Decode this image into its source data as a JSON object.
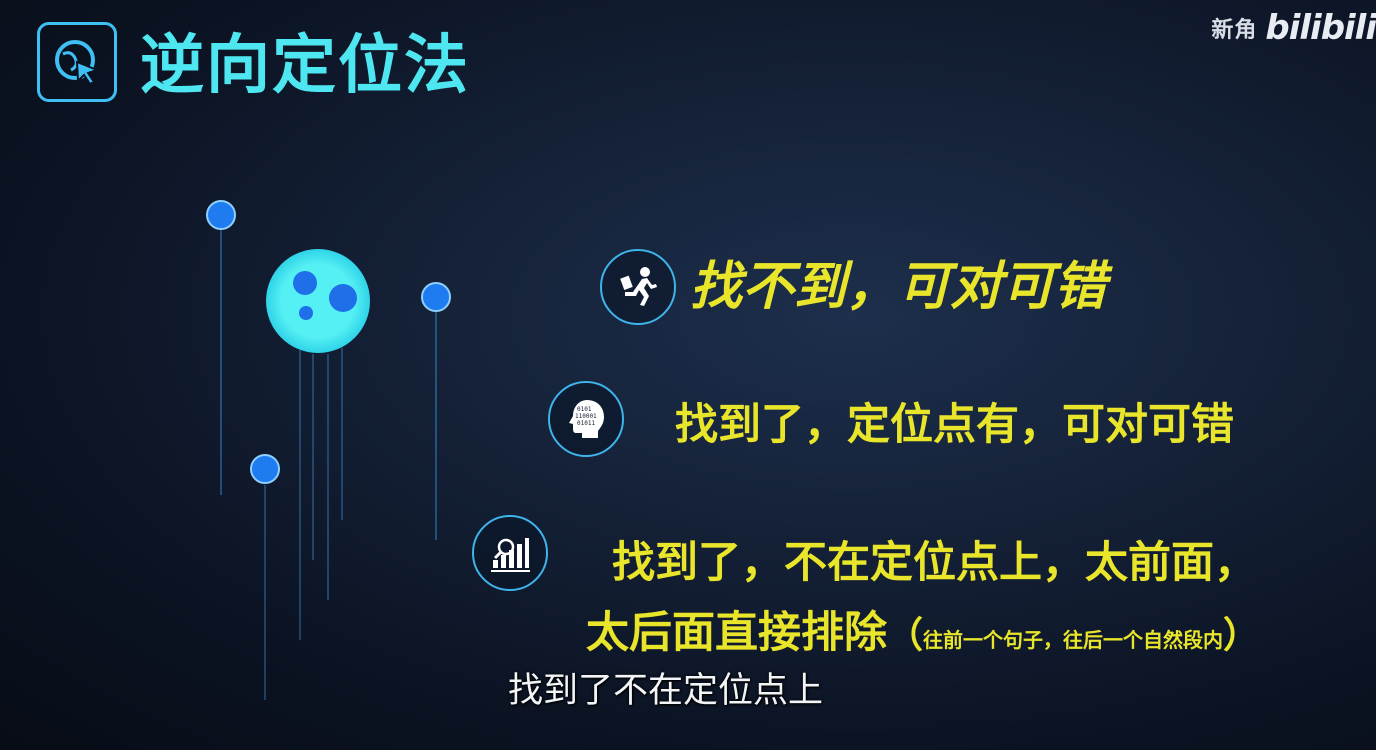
{
  "watermark": {
    "text": "新角",
    "logo": "bilibili"
  },
  "title": {
    "text": "逆向定位法",
    "icon": "globe-cursor-icon"
  },
  "items": [
    {
      "icon": "running-person-icon",
      "text": "找不到，可对可错"
    },
    {
      "icon": "brain-head-icon",
      "text": "找到了，定位点有，可对可错"
    },
    {
      "icon": "bar-chart-icon",
      "line1": "找到了，不在定位点上，太前面，",
      "line2_main": "太后面直接排除",
      "line2_open": "（",
      "line2_note": "往前一个句子，往后一个自然段内",
      "line2_close": "）"
    }
  ],
  "subtitle": "找到了不在定位点上",
  "colors": {
    "title": "#4ee6f0",
    "item_text": "#e8e52b",
    "accent": "#3fb4ea",
    "node": "#1e7cf0"
  }
}
